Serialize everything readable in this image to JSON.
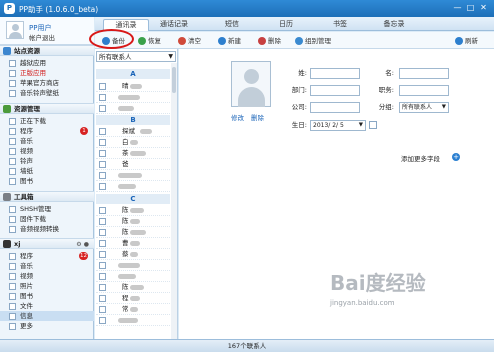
{
  "window": {
    "title": "PP助手 (1.0.6.0_beta)",
    "min_glyph": "—",
    "max_glyph": "□",
    "close_glyph": "✕"
  },
  "user": {
    "name": "PP用户",
    "logout": "帐户退出"
  },
  "sidebar": {
    "site_section": "站点资源",
    "site_items": [
      {
        "label": "越狱应用",
        "active": false
      },
      {
        "label": "正版应用",
        "active": true
      },
      {
        "label": "苹果官方商店",
        "active": false
      },
      {
        "label": "音乐铃声壁纸",
        "active": false
      }
    ],
    "res_section": "资源管理",
    "res_items": [
      {
        "label": "正在下载"
      },
      {
        "label": "程序",
        "badge": "1"
      },
      {
        "label": "音乐"
      },
      {
        "label": "视频"
      },
      {
        "label": "铃声"
      },
      {
        "label": "墙纸"
      },
      {
        "label": "图书"
      }
    ],
    "tools_section": "工具箱",
    "tools_items": [
      {
        "label": "SHSH管理"
      },
      {
        "label": "固件下载"
      },
      {
        "label": "音频视频转换"
      }
    ],
    "device_section": "xj",
    "device_items": [
      {
        "label": "程序",
        "badge": "12"
      },
      {
        "label": "音乐"
      },
      {
        "label": "视频"
      },
      {
        "label": "照片"
      },
      {
        "label": "图书"
      },
      {
        "label": "文件"
      },
      {
        "label": "信息"
      },
      {
        "label": "更多"
      }
    ]
  },
  "tabs": [
    "通讯录",
    "通话记录",
    "短信",
    "日历",
    "书签",
    "备忘录"
  ],
  "toolbar": {
    "backup": "备份",
    "restore": "恢复",
    "clear": "清空",
    "new": "新建",
    "delete": "删除",
    "group_manage": "组别管理",
    "refresh": "刷新"
  },
  "contacts": {
    "filter": "所有联系人",
    "groups": [
      {
        "letter": "A",
        "rows": [
          "晴",
          "",
          ""
        ]
      },
      {
        "letter": "B",
        "rows": [
          "探斌",
          "白",
          "茶",
          "爸"
        ]
      },
      {
        "letter": "C",
        "rows": [
          "陈",
          "陈",
          "陈",
          "曹",
          "蔡",
          "",
          "",
          "陈",
          "程",
          "常"
        ]
      }
    ],
    "count": "167个联系人"
  },
  "detail": {
    "edit": "修改",
    "delete": "删除",
    "fields": {
      "surname": "姓:",
      "given": "名:",
      "dept": "部门:",
      "position": "职务:",
      "company": "公司:",
      "group": "分组:",
      "group_value": "所有联系人",
      "birthday": "生日:",
      "birthday_value": "2013/ 2/ 5"
    },
    "add_more": "添加更多字段"
  },
  "watermark": {
    "text": "Bai度经验",
    "sub": "jingyan.baidu.com"
  }
}
